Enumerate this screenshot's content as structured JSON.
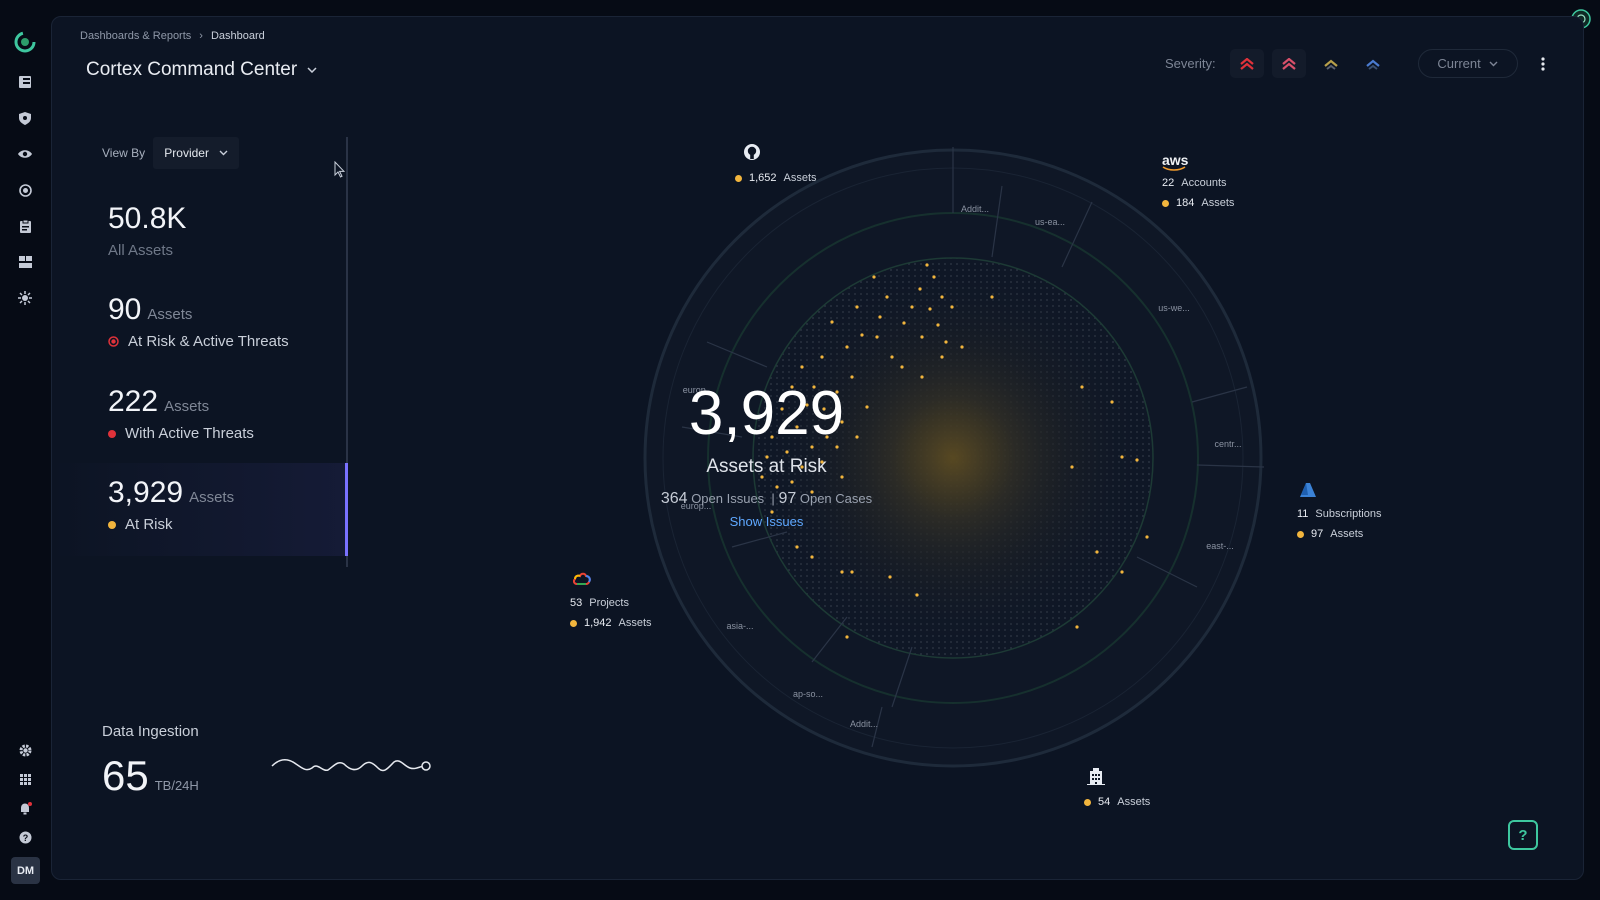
{
  "breadcrumb": {
    "parent": "Dashboards & Reports",
    "separator": "›",
    "current": "Dashboard"
  },
  "page_title": "Cortex Command Center",
  "severity": {
    "label": "Severity:",
    "time_selector": "Current"
  },
  "view_by": {
    "label": "View By",
    "value": "Provider"
  },
  "stats": [
    {
      "value": "50.8K",
      "unit": "",
      "label": "All Assets",
      "dot_color": ""
    },
    {
      "value": "90",
      "unit": "Assets",
      "label": "At Risk & Active Threats",
      "dot_color": "#e0323a"
    },
    {
      "value": "222",
      "unit": "Assets",
      "label": "With Active Threats",
      "dot_color": "#e0323a"
    },
    {
      "value": "3,929",
      "unit": "Assets",
      "label": "At Risk",
      "dot_color": "#f2b53d"
    }
  ],
  "ingestion": {
    "label": "Data Ingestion",
    "value": "65",
    "unit": "TB/24H"
  },
  "center": {
    "value": "3,929",
    "label": "Assets at Risk",
    "open_issues_count": "364",
    "open_issues_label": "Open Issues",
    "divider": "|",
    "open_cases_count": "97",
    "open_cases_label": "Open Cases",
    "link": "Show Issues"
  },
  "providers": {
    "github": {
      "assets": "1,652",
      "assets_label": "Assets"
    },
    "aws": {
      "logo_text": "aws",
      "accounts": "22",
      "accounts_label": "Accounts",
      "assets": "184",
      "assets_label": "Assets"
    },
    "azure": {
      "subscriptions": "11",
      "subscriptions_label": "Subscriptions",
      "assets": "97",
      "assets_label": "Assets"
    },
    "gcp": {
      "projects": "53",
      "projects_label": "Projects",
      "assets": "1,942",
      "assets_label": "Assets"
    },
    "onprem": {
      "assets": "54",
      "assets_label": "Assets"
    }
  },
  "regions": [
    "Addit...",
    "us-ea...",
    "us-we...",
    "centr...",
    "east-...",
    "Addit...",
    "ap-so...",
    "asia-...",
    "europ...",
    "europ..."
  ],
  "user": {
    "initials": "DM"
  },
  "help": "?",
  "colors": {
    "accent": "#7a72ff",
    "risk": "#f2b53d",
    "threat": "#e0323a",
    "link": "#5fa8ff",
    "brand": "#3ec79f"
  }
}
